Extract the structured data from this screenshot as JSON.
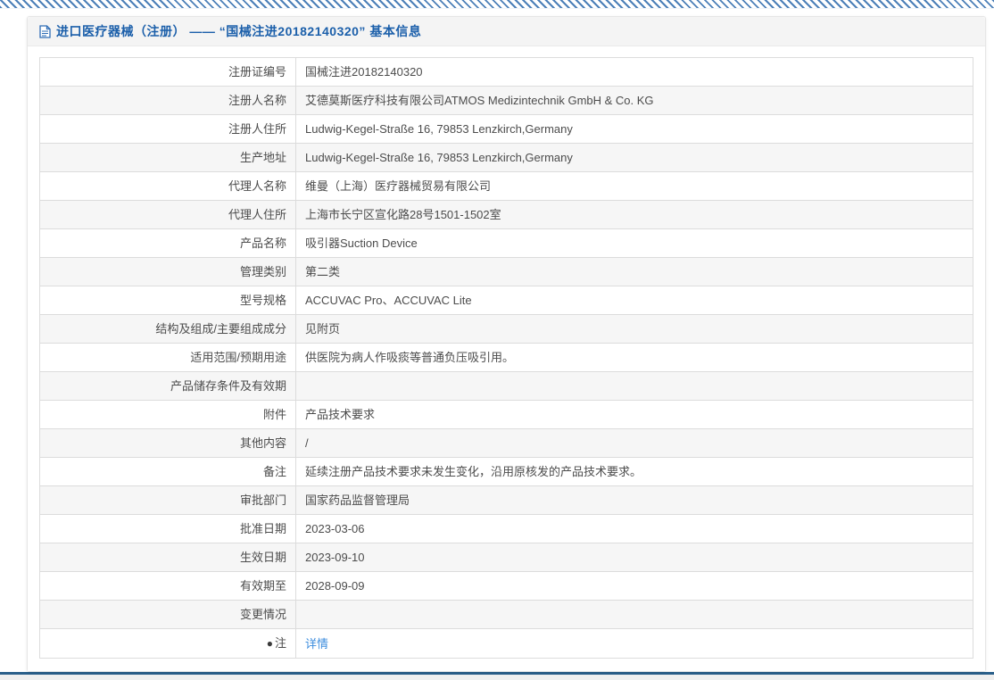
{
  "panel": {
    "title": "进口医疗器械（注册） —— “国械注进20182140320” 基本信息",
    "table": {
      "rows": [
        {
          "label": "注册证编号",
          "value": "国械注进20182140320"
        },
        {
          "label": "注册人名称",
          "value": "艾德莫斯医疗科技有限公司ATMOS Medizintechnik GmbH & Co. KG"
        },
        {
          "label": "注册人住所",
          "value": "Ludwig-Kegel-Straße 16, 79853 Lenzkirch,Germany"
        },
        {
          "label": "生产地址",
          "value": "Ludwig-Kegel-Straße 16, 79853 Lenzkirch,Germany"
        },
        {
          "label": "代理人名称",
          "value": "维曼（上海）医疗器械贸易有限公司"
        },
        {
          "label": "代理人住所",
          "value": "上海市长宁区宣化路28号1501-1502室"
        },
        {
          "label": "产品名称",
          "value": "吸引器Suction Device"
        },
        {
          "label": "管理类别",
          "value": "第二类"
        },
        {
          "label": "型号规格",
          "value": "ACCUVAC Pro、ACCUVAC Lite"
        },
        {
          "label": "结构及组成/主要组成成分",
          "value": "见附页"
        },
        {
          "label": "适用范围/预期用途",
          "value": "供医院为病人作吸痰等普通负压吸引用。"
        },
        {
          "label": "产品储存条件及有效期",
          "value": ""
        },
        {
          "label": "附件",
          "value": "产品技术要求"
        },
        {
          "label": "其他内容",
          "value": "/"
        },
        {
          "label": "备注",
          "value": "延续注册产品技术要求未发生变化，沿用原核发的产品技术要求。"
        },
        {
          "label": "审批部门",
          "value": "国家药品监督管理局"
        },
        {
          "label": "批准日期",
          "value": "2023-03-06"
        },
        {
          "label": "生效日期",
          "value": "2023-09-10"
        },
        {
          "label": "有效期至",
          "value": "2028-09-09"
        },
        {
          "label": "变更情况",
          "value": ""
        },
        {
          "label": "注",
          "label_icon": "●",
          "value": "详情",
          "is_link": true
        }
      ]
    }
  },
  "colors": {
    "accent_blue": "#1b5faa",
    "link_blue": "#3c8dde",
    "stripe_blue": "#4c80b8",
    "footer_line_blue": "#2a5f8a",
    "zebra_gray": "#f6f6f6"
  }
}
